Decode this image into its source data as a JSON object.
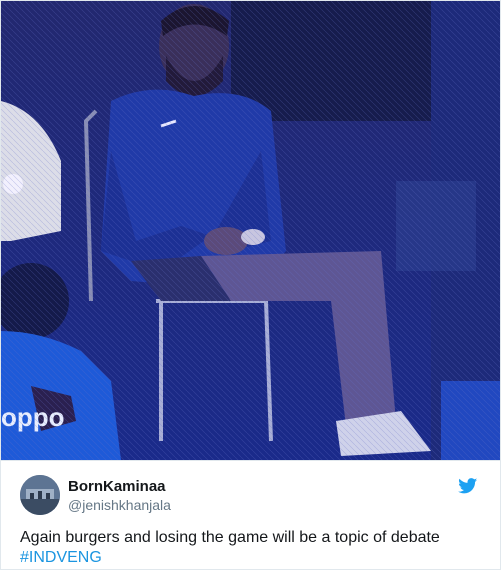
{
  "tweet": {
    "display_name": "BornKaminaa",
    "handle": "@jenishkhanjala",
    "text": "Again burgers and losing the game will be a topic of debate",
    "hashtag": "#INDVENG"
  },
  "colors": {
    "hashtag": "#1b95e0",
    "twitter_bird": "#1da1f2",
    "name": "#14171a",
    "handle": "#657786"
  },
  "icons": {
    "brand": "twitter-bird-icon"
  },
  "media": {
    "jersey_logo_text": "oppo"
  }
}
